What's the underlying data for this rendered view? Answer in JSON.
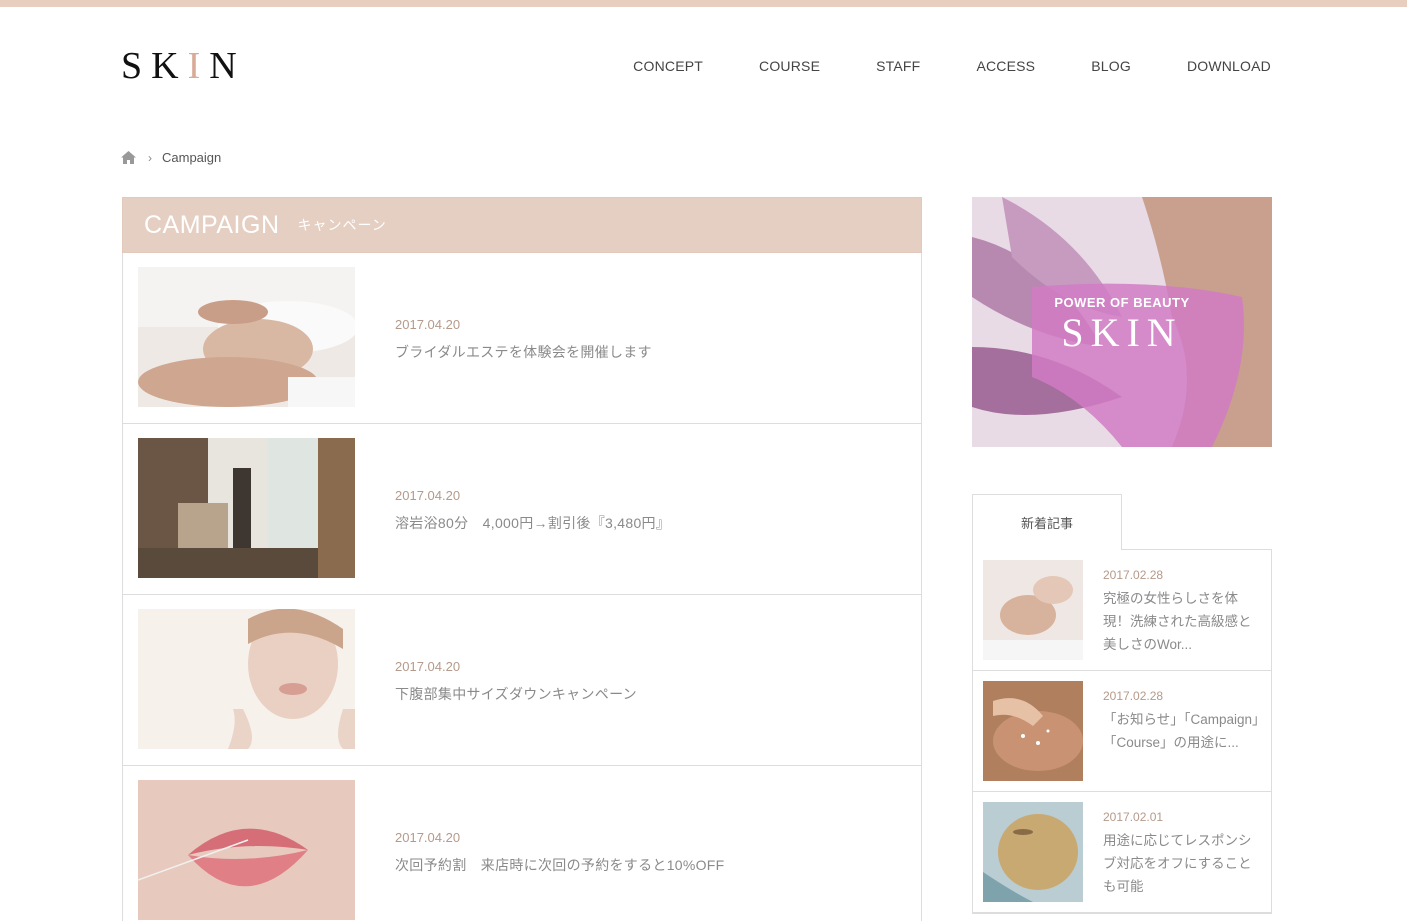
{
  "header": {
    "logo_pre": "SK",
    "logo_accent": "I",
    "logo_post": "N",
    "nav": [
      "CONCEPT",
      "COURSE",
      "STAFF",
      "ACCESS",
      "BLOG",
      "DOWNLOAD"
    ]
  },
  "breadcrumb": {
    "current": "Campaign"
  },
  "main": {
    "heading": "CAMPAIGN",
    "subheading": "キャンペーン",
    "posts": [
      {
        "date": "2017.04.20",
        "title": "ブライダルエステを体験会を開催します"
      },
      {
        "date": "2017.04.20",
        "title": "溶岩浴80分　4,000円→割引後『3,480円』"
      },
      {
        "date": "2017.04.20",
        "title": "下腹部集中サイズダウンキャンペーン"
      },
      {
        "date": "2017.04.20",
        "title": "次回予約割　来店時に次回の予約をすると10%OFF"
      }
    ]
  },
  "sidebar": {
    "banner_tagline": "POWER OF BEAUTY",
    "banner_logo": "SKIN",
    "tab_label": "新着記事",
    "items": [
      {
        "date": "2017.02.28",
        "title": "究極の女性らしさを体現！洗練された高級感と美しさのWor..."
      },
      {
        "date": "2017.02.28",
        "title": "「お知らせ」「Campaign」「Course」の用途に..."
      },
      {
        "date": "2017.02.01",
        "title": "用途に応じてレスポンシブ対応をオフにすることも可能"
      }
    ]
  },
  "colors": {
    "accent": "#e5cfc2",
    "date": "#b59a8a",
    "topbar": "#e7cebe"
  }
}
